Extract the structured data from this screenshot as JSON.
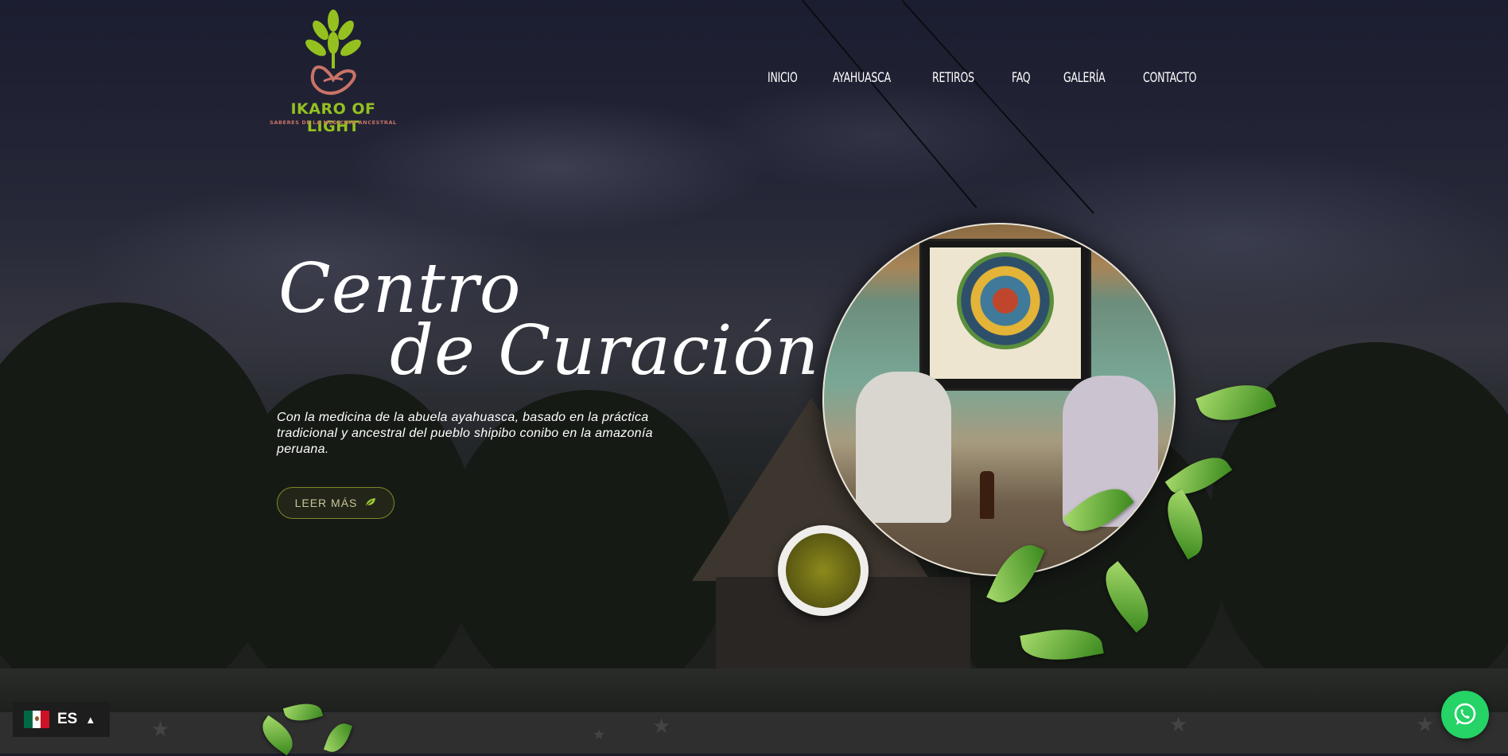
{
  "brand": {
    "name": "IKARO OF LIGHT",
    "tagline": "SABERES DE LA MEDICINA ANCESTRAL",
    "primary_color": "#94c11f",
    "secondary_color": "#c97466"
  },
  "nav": {
    "items": [
      {
        "label": "INICIO"
      },
      {
        "label": "AYAHUASCA"
      },
      {
        "label": "RETIROS"
      },
      {
        "label": "FAQ"
      },
      {
        "label": "GALERÍA"
      },
      {
        "label": "CONTACTO"
      }
    ]
  },
  "hero": {
    "title_line1": "Centro",
    "title_line2": "de Curación",
    "subtitle": "Con la medicina de la abuela ayahuasca, basado en la práctica tradicional y ancestral del pueblo shipibo conibo en la amazonía peruana.",
    "cta_label": "LEER MÁS",
    "cta_icon": "leaf-icon"
  },
  "language": {
    "code": "ES",
    "flag": "mexico-flag-icon"
  },
  "whatsapp": {
    "icon": "whatsapp-icon",
    "color": "#25d366"
  }
}
